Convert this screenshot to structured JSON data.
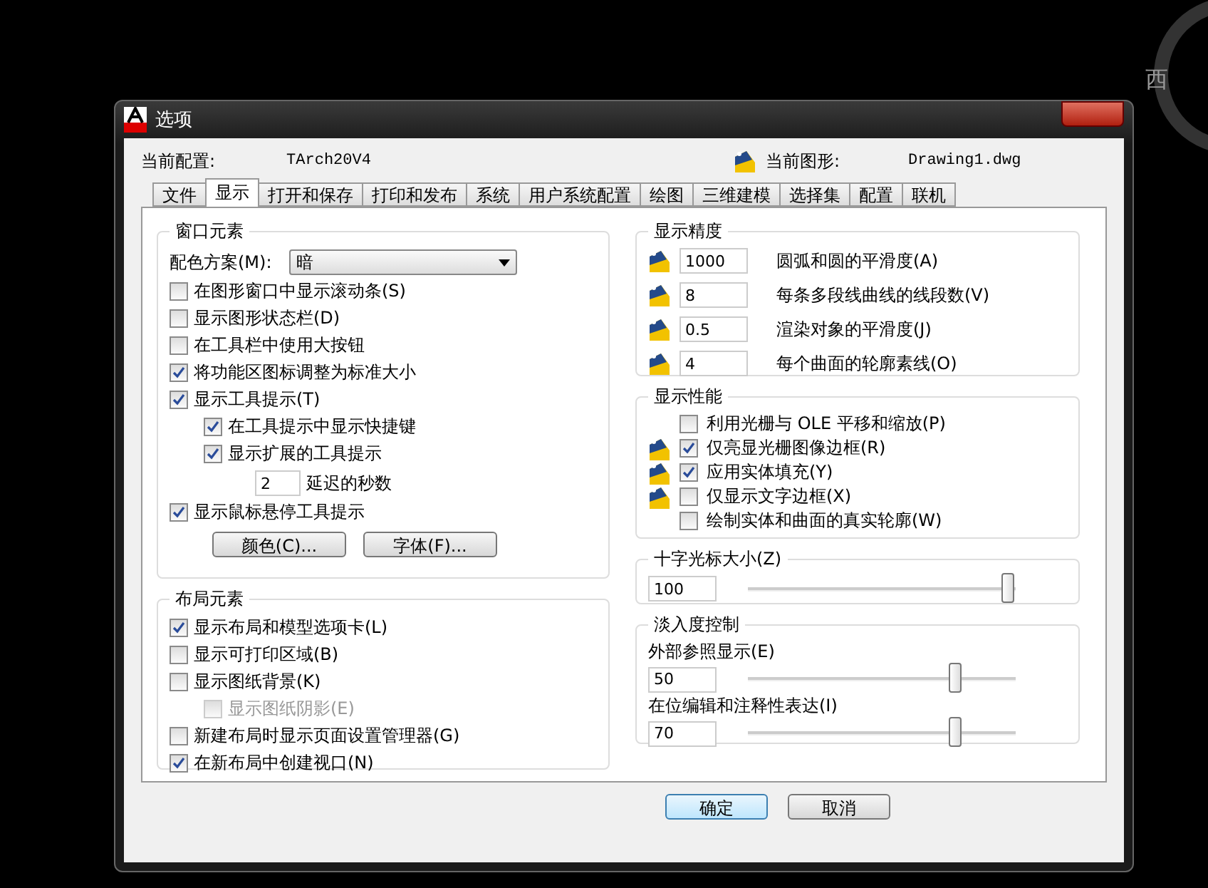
{
  "desktop": {
    "compass_label": "西"
  },
  "window": {
    "title": "选项"
  },
  "header": {
    "profile_label": "当前配置:",
    "profile_value": "TArch20V4",
    "drawing_label": "当前图形:",
    "drawing_value": "Drawing1.dwg"
  },
  "tabs": [
    {
      "label": "文件",
      "selected": false
    },
    {
      "label": "显示",
      "selected": true
    },
    {
      "label": "打开和保存",
      "selected": false
    },
    {
      "label": "打印和发布",
      "selected": false
    },
    {
      "label": "系统",
      "selected": false
    },
    {
      "label": "用户系统配置",
      "selected": false
    },
    {
      "label": "绘图",
      "selected": false
    },
    {
      "label": "三维建模",
      "selected": false
    },
    {
      "label": "选择集",
      "selected": false
    },
    {
      "label": "配置",
      "selected": false
    },
    {
      "label": "联机",
      "selected": false
    }
  ],
  "window_elements": {
    "title": "窗口元素",
    "scheme_label": "配色方案(M):",
    "scheme_value": "暗",
    "items": [
      {
        "kind": "check",
        "label": "在图形窗口中显示滚动条(S)",
        "checked": false,
        "disabled": false
      },
      {
        "kind": "check",
        "label": "显示图形状态栏(D)",
        "checked": false,
        "disabled": false
      },
      {
        "kind": "check",
        "label": "在工具栏中使用大按钮",
        "checked": false,
        "disabled": false
      },
      {
        "kind": "check",
        "label": "将功能区图标调整为标准大小",
        "checked": true,
        "disabled": false
      },
      {
        "kind": "check",
        "label": "显示工具提示(T)",
        "checked": true,
        "disabled": false,
        "children": [
          {
            "kind": "check",
            "label": "在工具提示中显示快捷键",
            "checked": true,
            "disabled": false
          },
          {
            "kind": "check",
            "label": "显示扩展的工具提示",
            "checked": true,
            "disabled": false,
            "children": [
              {
                "kind": "number",
                "value": "2",
                "label": "延迟的秒数"
              }
            ]
          }
        ]
      },
      {
        "kind": "check",
        "label": "显示鼠标悬停工具提示",
        "checked": true,
        "disabled": false
      }
    ],
    "buttons": [
      "颜色(C)...",
      "字体(F)..."
    ]
  },
  "layout_elements": {
    "title": "布局元素",
    "items": [
      {
        "kind": "check",
        "label": "显示布局和模型选项卡(L)",
        "checked": true,
        "disabled": false
      },
      {
        "kind": "check",
        "label": "显示可打印区域(B)",
        "checked": false,
        "disabled": false
      },
      {
        "kind": "check",
        "label": "显示图纸背景(K)",
        "checked": false,
        "disabled": false,
        "children": [
          {
            "kind": "check",
            "label": "显示图纸阴影(E)",
            "checked": false,
            "disabled": true
          }
        ]
      },
      {
        "kind": "check",
        "label": "新建布局时显示页面设置管理器(G)",
        "checked": false,
        "disabled": false
      },
      {
        "kind": "check",
        "label": "在新布局中创建视口(N)",
        "checked": true,
        "disabled": false
      }
    ]
  },
  "display_resolution": {
    "title": "显示精度",
    "items": [
      {
        "value": "1000",
        "label": "圆弧和圆的平滑度(A)"
      },
      {
        "value": "8",
        "label": "每条多段线曲线的线段数(V)"
      },
      {
        "value": "0.5",
        "label": "渲染对象的平滑度(J)"
      },
      {
        "value": "4",
        "label": "每个曲面的轮廓素线(O)"
      }
    ]
  },
  "display_performance": {
    "title": "显示性能",
    "items": [
      {
        "kind": "plain",
        "label": "利用光栅与 OLE 平移和缩放(P)",
        "checked": false
      },
      {
        "kind": "drawing",
        "label": "仅亮显光栅图像边框(R)",
        "checked": true
      },
      {
        "kind": "drawing",
        "label": "应用实体填充(Y)",
        "checked": true
      },
      {
        "kind": "drawing",
        "label": "仅显示文字边框(X)",
        "checked": false
      },
      {
        "kind": "plain",
        "label": "绘制实体和曲面的真实轮廓(W)",
        "checked": false
      }
    ]
  },
  "crosshair": {
    "title": "十字光标大小(Z)",
    "value": "100",
    "level": 0.97
  },
  "fade_control": {
    "title": "淡入度控制",
    "items": [
      {
        "label": "外部参照显示(E)",
        "value": "50",
        "level": 0.77
      },
      {
        "label": "在位编辑和注释性表达(I)",
        "value": "70",
        "level": 0.77
      }
    ]
  },
  "buttons": [
    "确定",
    "取消"
  ]
}
